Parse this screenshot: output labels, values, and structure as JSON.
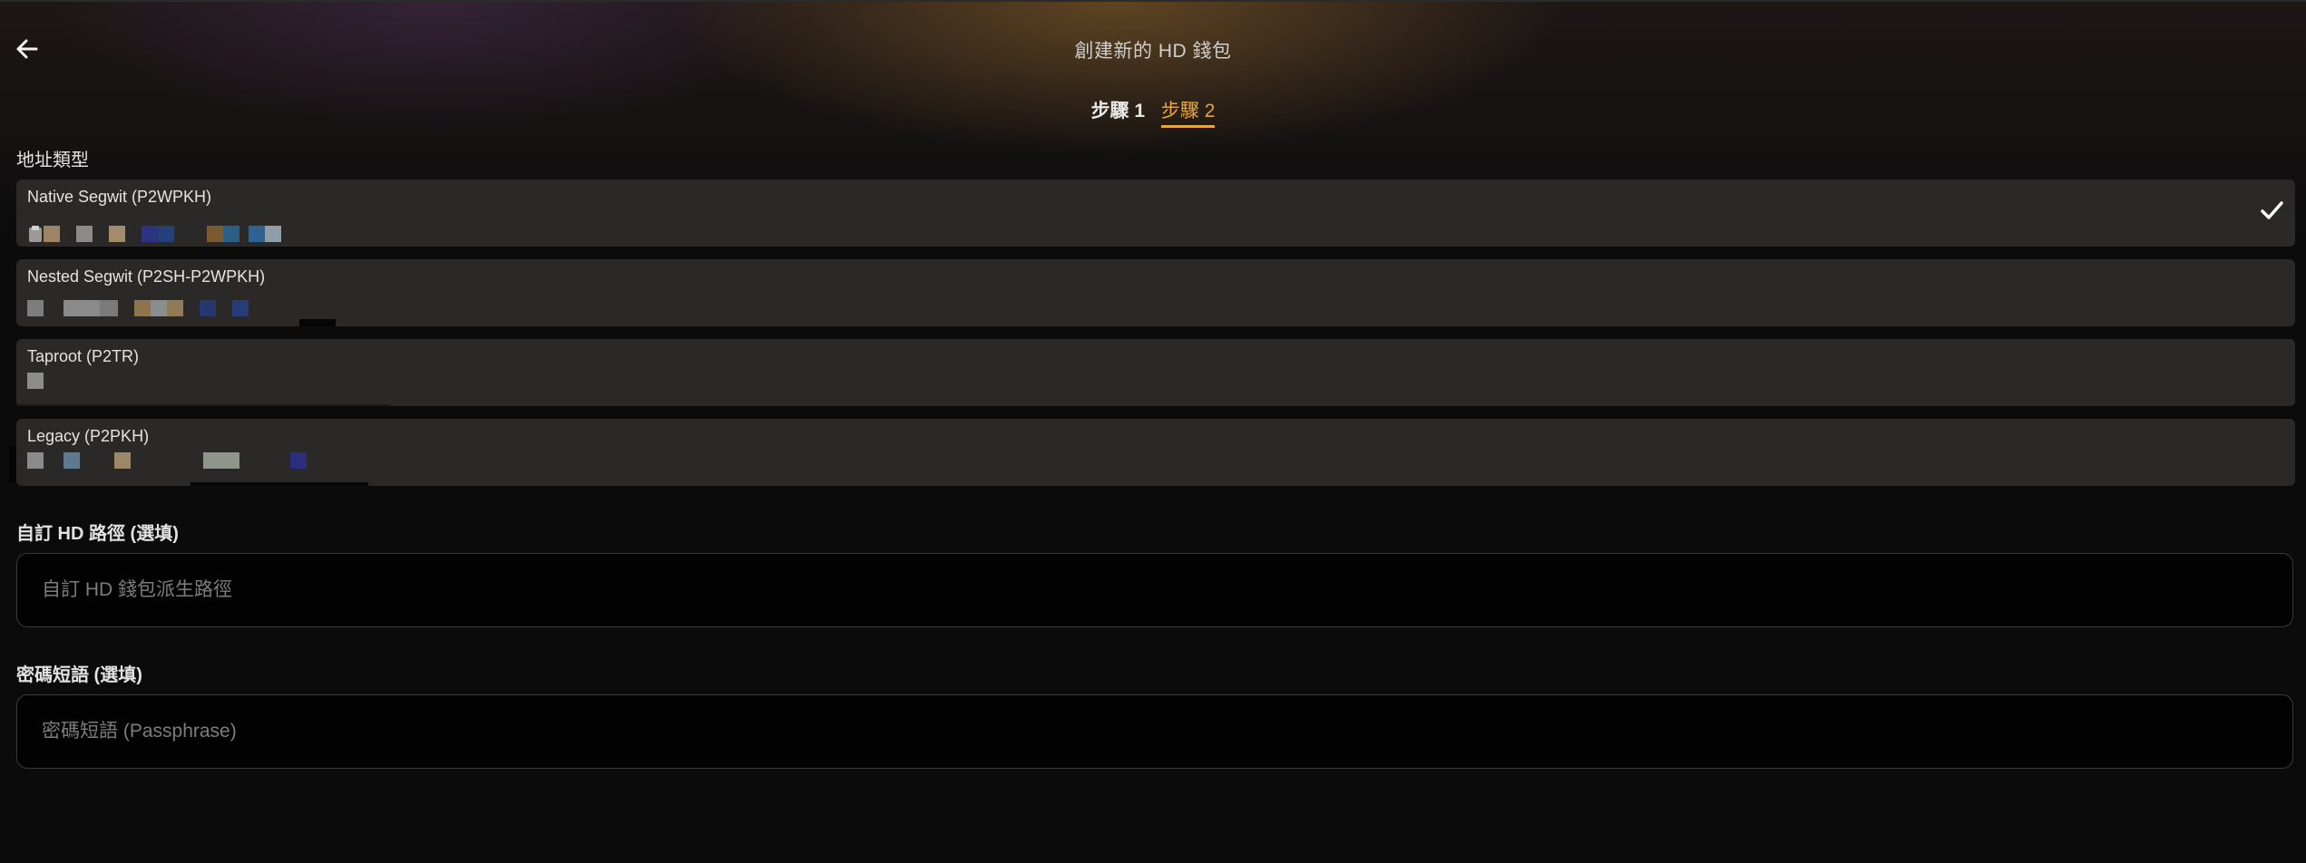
{
  "header": {
    "title": "創建新的 HD 錢包",
    "back_icon": "arrow-left-icon"
  },
  "steps": [
    {
      "label": "步驟 1",
      "active": false
    },
    {
      "label": "步驟 2",
      "active": true
    }
  ],
  "colors": {
    "accent": "#e6a73a",
    "card_bg": "#2b2828",
    "input_bg": "#020202"
  },
  "address_type": {
    "label": "地址類型",
    "options": [
      {
        "name": "Native Segwit (P2WPKH)",
        "selected": true
      },
      {
        "name": "Nested Segwit (P2SH-P2WPKH)",
        "selected": false
      },
      {
        "name": "Taproot (P2TR)",
        "selected": false
      },
      {
        "name": "Legacy (P2PKH)",
        "selected": false
      }
    ]
  },
  "custom_path": {
    "label": "自訂 HD 路徑 (選填)",
    "placeholder": "自訂 HD 錢包派生路徑",
    "value": ""
  },
  "passphrase": {
    "label": "密碼短語 (選填)",
    "placeholder": "密碼短語 (Passphrase)",
    "value": ""
  }
}
